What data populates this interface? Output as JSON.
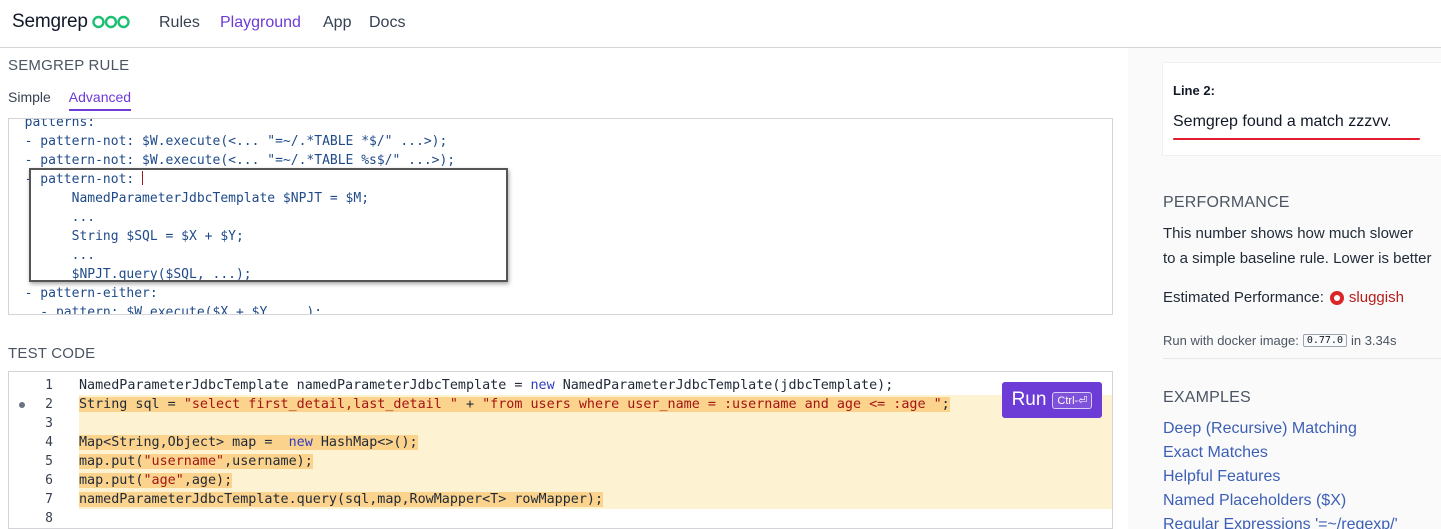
{
  "nav": {
    "brand": "Semgrep",
    "links": [
      "Rules",
      "Playground",
      "App",
      "Docs"
    ],
    "active": "Playground"
  },
  "rule_section": {
    "title": "SEMGREP RULE",
    "tabs": [
      "Simple",
      "Advanced"
    ],
    "active_tab": "Advanced",
    "lines": [
      "  patterns:",
      "  - pattern-not: $W.execute(<... \"=~/.*TABLE *$/\" ...>);",
      "  - pattern-not: $W.execute(<... \"=~/.*TABLE %s$/\" ...>);",
      "  - pattern-not: ",
      "        NamedParameterJdbcTemplate $NPJT = $M;",
      "        ...",
      "        String $SQL = $X + $Y;",
      "        ...",
      "        $NPJT.query($SQL, ...);",
      "  - pattern-either:",
      "    - pattern: $W.execute($X + $Y, ...);"
    ]
  },
  "test_section": {
    "title": "TEST CODE",
    "run_label": "Run",
    "run_shortcut": "Ctrl-⏎",
    "lines": [
      {
        "n": "1",
        "text": "NamedParameterJdbcTemplate namedParameterJdbcTemplate = new NamedParameterJdbcTemplate(jdbcTemplate);",
        "highlight": false
      },
      {
        "n": "2",
        "text": "String sql = \"select first_detail,last_detail \" + \"from users where user_name = :username and age <= :age \";",
        "highlight": true
      },
      {
        "n": "3",
        "text": "",
        "highlight": true
      },
      {
        "n": "4",
        "text": "Map<String,Object> map =  new HashMap<>();",
        "highlight": true
      },
      {
        "n": "5",
        "text": "map.put(\"username\",username);",
        "highlight": true
      },
      {
        "n": "6",
        "text": "map.put(\"age\",age);",
        "highlight": true
      },
      {
        "n": "7",
        "text": "namedParameterJdbcTemplate.query(sql,map,RowMapper<T> rowMapper);",
        "highlight": true
      },
      {
        "n": "8",
        "text": "",
        "highlight": false
      }
    ]
  },
  "results": {
    "line_title": "Line 2:",
    "message": "Semgrep found a match zzzvv."
  },
  "performance": {
    "title": "PERFORMANCE",
    "desc_1": "This number shows how much slower",
    "desc_2": "to a simple baseline rule. Lower is better",
    "estimate_label": "Estimated Performance:",
    "estimate_value": "sluggish",
    "docker_prefix": "Run with docker image:",
    "docker_version": "0.77.0",
    "docker_suffix": "in 3.34s",
    "status_color": "#dc2626"
  },
  "examples": {
    "title": "EXAMPLES",
    "items": [
      "Deep (Recursive) Matching",
      "Exact Matches",
      "Helpful Features",
      "Named Placeholders ($X)",
      "Regular Expressions '=~/regexp/'"
    ]
  },
  "colors": {
    "accent": "#6d3bd6",
    "link": "#3c5fb5",
    "match_underline": "#e11d2e",
    "highlight_line": "#fdf2d2",
    "highlight_mark": "#fbd38d"
  }
}
